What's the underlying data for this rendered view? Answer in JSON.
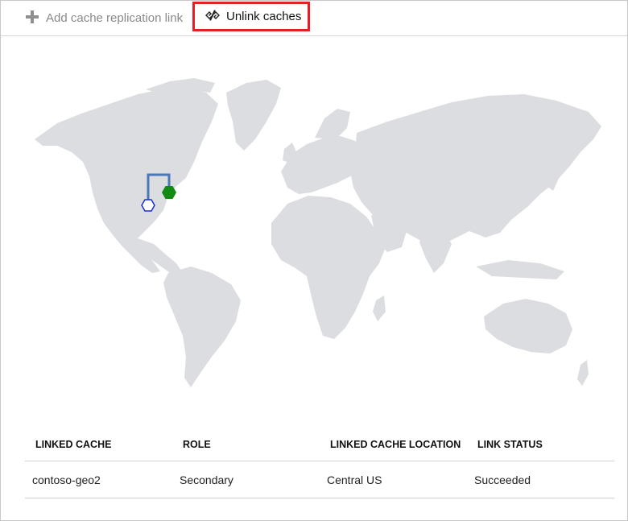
{
  "toolbar": {
    "add_label": "Add cache replication link",
    "unlink_label": "Unlink caches",
    "add_icon": "plus-icon",
    "unlink_icon": "unlink-icon"
  },
  "map": {
    "primary_marker": {
      "icon": "hexagon-filled-icon",
      "color": "#138a13"
    },
    "secondary_marker": {
      "icon": "hexagon-outline-icon",
      "color": "#1a2ed0"
    },
    "link_color": "#4a78b8",
    "land_color": "#dcdde0"
  },
  "table": {
    "headers": [
      "LINKED CACHE",
      "ROLE",
      "LINKED CACHE LOCATION",
      "LINK STATUS"
    ],
    "rows": [
      [
        "contoso-geo2",
        "Secondary",
        "Central US",
        "Succeeded"
      ]
    ]
  }
}
